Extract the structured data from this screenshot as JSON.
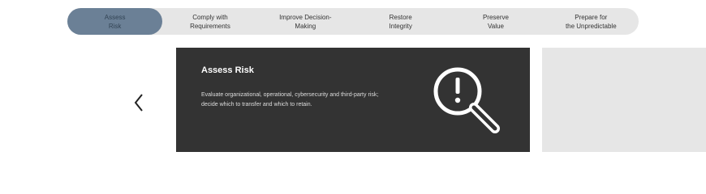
{
  "tabs": [
    {
      "label": "Assess\nRisk",
      "active": true
    },
    {
      "label": "Comply with\nRequirements",
      "active": false
    },
    {
      "label": "Improve Decision-\nMaking",
      "active": false
    },
    {
      "label": "Restore\nIntegrity",
      "active": false
    },
    {
      "label": "Preserve\nValue",
      "active": false
    },
    {
      "label": "Prepare for\nthe Unpredictable",
      "active": false
    }
  ],
  "card": {
    "title": "Assess Risk",
    "description": "Evaluate organizational, operational, cybersecurity and third-party risk; decide which to transfer and which to retain.",
    "icon": "magnifier-exclamation-icon"
  },
  "nav": {
    "prev_icon": "chevron-left-icon",
    "next_icon": "chevron-right-icon"
  },
  "colors": {
    "active_tab": "#6b8096",
    "tabbar": "#e6e6e6",
    "card_bg": "#333333",
    "next_card_bg": "#e6e6e6"
  }
}
